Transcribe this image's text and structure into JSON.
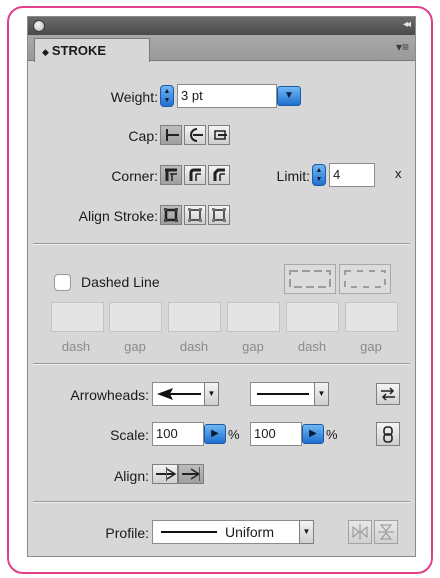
{
  "panel": {
    "tab_title": "STROKE",
    "tab_arrows": "◆",
    "menu_glyph": "▾≡",
    "collapse_glyph": "◂◂"
  },
  "weight": {
    "label": "Weight:",
    "value": "3 pt"
  },
  "cap": {
    "label": "Cap:"
  },
  "corner": {
    "label": "Corner:"
  },
  "limit": {
    "label": "Limit:",
    "value": "4",
    "suffix": "x"
  },
  "align_stroke": {
    "label": "Align Stroke:"
  },
  "dashed": {
    "label": "Dashed Line",
    "checked": false,
    "fields": [
      "dash",
      "gap",
      "dash",
      "gap",
      "dash",
      "gap"
    ]
  },
  "arrowheads": {
    "label": "Arrowheads:"
  },
  "scale": {
    "label": "Scale:",
    "start": "100",
    "end": "100",
    "unit": "%"
  },
  "align": {
    "label": "Align:"
  },
  "profile": {
    "label": "Profile:",
    "value": "Uniform"
  },
  "colors": {
    "frame": "#e0408a",
    "accent": "#1f6fd1",
    "panel": "#d7d7d7"
  }
}
